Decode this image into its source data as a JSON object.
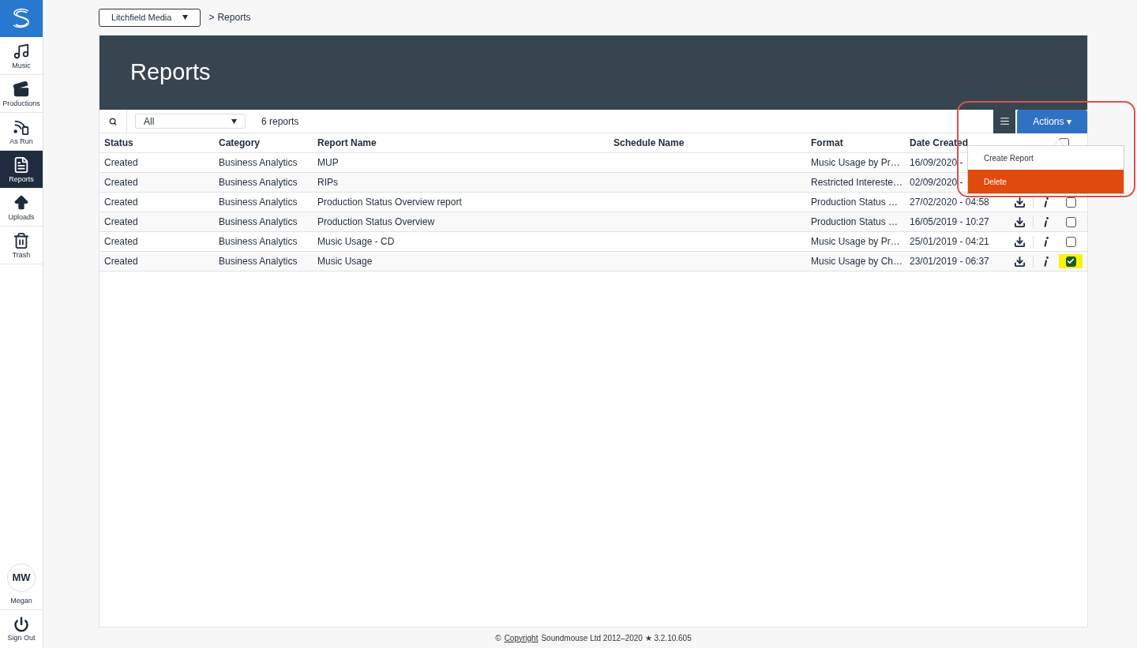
{
  "sidebar": {
    "items": [
      {
        "kind": "music",
        "label": "Music",
        "selected": false
      },
      {
        "kind": "productions",
        "label": "Productions",
        "selected": false
      },
      {
        "kind": "asrun",
        "label": "As Run",
        "selected": false
      },
      {
        "kind": "reports",
        "label": "Reports",
        "selected": true
      },
      {
        "kind": "uploads",
        "label": "Uploads",
        "selected": false
      },
      {
        "kind": "trash",
        "label": "Trash",
        "selected": false
      }
    ],
    "user": {
      "initials": "MW",
      "name": "Megan"
    },
    "sign_out": "Sign Out"
  },
  "breadcrumb": {
    "organisation": "Litchfield Media",
    "separator": ">",
    "current": "Reports"
  },
  "page_title": "Reports",
  "toolbar": {
    "filter": "All",
    "count": "6 reports",
    "actions_button": "Actions ▾"
  },
  "actions_menu": {
    "items": [
      {
        "label": "Create Report",
        "selected": false
      },
      {
        "label": "Delete",
        "selected": true
      }
    ]
  },
  "table": {
    "columns": [
      "Status",
      "Category",
      "Report Name",
      "Schedule Name",
      "Format",
      "Date Created"
    ],
    "select_all": {
      "checked": false
    },
    "rows": [
      {
        "cells": [
          "Created",
          "Business Analytics",
          "MUP",
          "",
          "Music Usage by Pr…",
          "16/09/2020 -"
        ]
      },
      {
        "cells": [
          "Created",
          "Business Analytics",
          "RIPs",
          "",
          "Restricted Intereste…",
          "02/09/2020 -"
        ]
      },
      {
        "cells": [
          "Created",
          "Business Analytics",
          "Production Status Overview report",
          "",
          "Production Status …",
          "27/02/2020 - 04:58"
        ],
        "checked": false
      },
      {
        "cells": [
          "Created",
          "Business Analytics",
          "Production Status Overview",
          "",
          "Production Status …",
          "16/05/2019 - 10:27"
        ],
        "checked": false
      },
      {
        "cells": [
          "Created",
          "Business Analytics",
          "Music Usage - CD",
          "",
          "Music Usage by Pr…",
          "25/01/2019 - 04:21"
        ],
        "checked": false
      },
      {
        "cells": [
          "Created",
          "Business Analytics",
          "Music Usage",
          "",
          "Music Usage by Ch…",
          "23/01/2019 - 06:37"
        ],
        "checked": true
      }
    ]
  },
  "footer": {
    "symbol": "©",
    "link": "Copyright",
    "text": "Soundmouse Ltd 2012–2020 ★ 3.2.10.605"
  }
}
